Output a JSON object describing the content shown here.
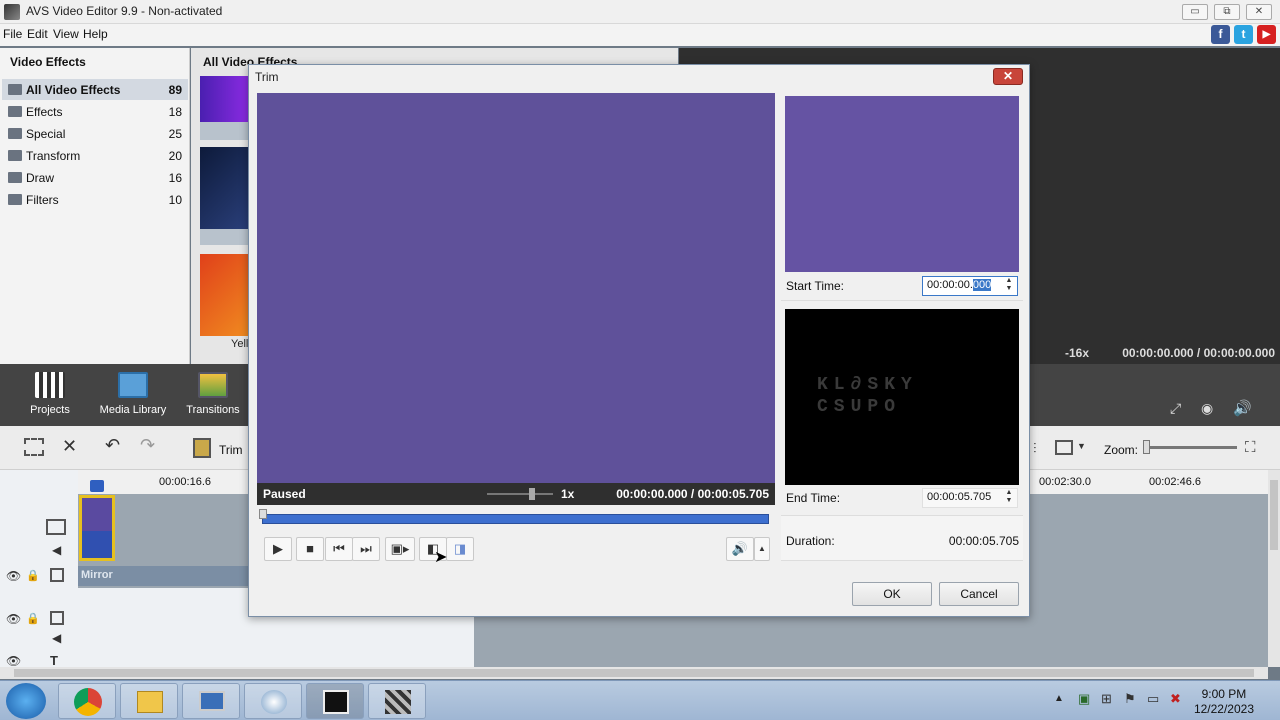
{
  "window": {
    "title": "AVS Video Editor 9.9 - Non-activated",
    "minimize": "▭",
    "restore": "⧉",
    "close": "✕"
  },
  "menu": [
    "File",
    "Edit",
    "View",
    "Help"
  ],
  "social": {
    "facebook": "f",
    "twitter": "t",
    "youtube": "▶"
  },
  "effects_panel": {
    "heading": "Video Effects",
    "items": [
      {
        "label": "All Video Effects",
        "count": "89"
      },
      {
        "label": "Effects",
        "count": "18"
      },
      {
        "label": "Special",
        "count": "25"
      },
      {
        "label": "Transform",
        "count": "20"
      },
      {
        "label": "Draw",
        "count": "16"
      },
      {
        "label": "Filters",
        "count": "10"
      }
    ]
  },
  "effects_grid": {
    "heading": "All Video Effects",
    "partial_label": "Yell"
  },
  "preview": {
    "speed": "-16x",
    "time": "00:00:00.000 / 00:00:00.000"
  },
  "nav": {
    "projects": "Projects",
    "media_library": "Media Library",
    "transitions": "Transitions"
  },
  "timeline": {
    "trim_label": "Trim",
    "zoom_label": "Zoom:",
    "ruler": [
      "00:00:16.6",
      "00:02:30.0",
      "00:02:46.6"
    ],
    "track_label": "Mirror"
  },
  "trim_dialog": {
    "title": "Trim",
    "status": "Paused",
    "speed": "1x",
    "time": "00:00:00.000  /  00:00:05.705",
    "start_label": "Start Time:",
    "start_value_prefix": "00:00:00.",
    "start_value_selected": "000",
    "end_label": "End Time:",
    "end_value": "00:00:05.705",
    "duration_label": "Duration:",
    "duration_value": "00:00:05.705",
    "logo_line1": "KL∂SKY",
    "logo_line2": "CSUPO",
    "ok": "OK",
    "cancel": "Cancel"
  },
  "clock": {
    "time": "9:00 PM",
    "date": "12/22/2023"
  },
  "colors": {
    "accent": "#3a78c8",
    "video_purple": "#5f519a",
    "dark_bar": "#2f2f2f"
  }
}
